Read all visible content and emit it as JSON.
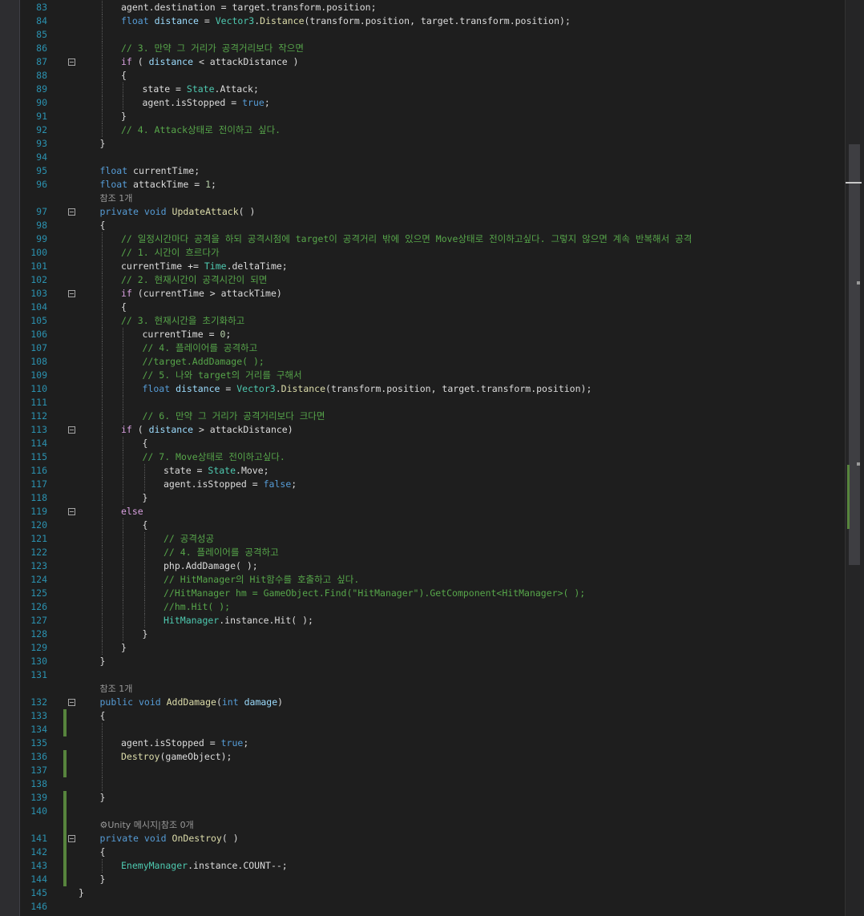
{
  "editor": {
    "lines": [
      {
        "type": "code",
        "ln": "83",
        "indent": 2,
        "fold": false,
        "chg": false,
        "tokens": [
          [
            "agent.",
            "p"
          ],
          [
            "destination",
            "p"
          ],
          [
            " = target.transform.position;",
            "p"
          ]
        ]
      },
      {
        "type": "code",
        "ln": "84",
        "indent": 2,
        "fold": false,
        "chg": false,
        "tokens": [
          [
            "float",
            "kw"
          ],
          [
            " ",
            "p"
          ],
          [
            "distance",
            "id"
          ],
          [
            " = ",
            "p"
          ],
          [
            "Vector3",
            "ty"
          ],
          [
            ".",
            "p"
          ],
          [
            "Distance",
            "mth"
          ],
          [
            "(transform.position, target.transform.position);",
            "p"
          ]
        ]
      },
      {
        "type": "code",
        "ln": "85",
        "indent": 2,
        "fold": false,
        "chg": false,
        "tokens": []
      },
      {
        "type": "code",
        "ln": "86",
        "indent": 2,
        "fold": false,
        "chg": false,
        "tokens": [
          [
            "// 3. 만약 그 거리가 공격거리보다 작으면",
            "cm"
          ]
        ]
      },
      {
        "type": "code",
        "ln": "87",
        "indent": 2,
        "fold": true,
        "chg": false,
        "tokens": [
          [
            "if",
            "ctl"
          ],
          [
            " ( ",
            "p"
          ],
          [
            "distance",
            "id"
          ],
          [
            " < attackDistance )",
            "p"
          ]
        ]
      },
      {
        "type": "code",
        "ln": "88",
        "indent": 2,
        "fold": false,
        "chg": false,
        "tokens": [
          [
            "{",
            "p"
          ]
        ]
      },
      {
        "type": "code",
        "ln": "89",
        "indent": 3,
        "fold": false,
        "chg": false,
        "tokens": [
          [
            "state = ",
            "p"
          ],
          [
            "State",
            "ty"
          ],
          [
            ".Attack;",
            "p"
          ]
        ]
      },
      {
        "type": "code",
        "ln": "90",
        "indent": 3,
        "fold": false,
        "chg": false,
        "tokens": [
          [
            "agent.isStopped = ",
            "p"
          ],
          [
            "true",
            "kw"
          ],
          [
            ";",
            "p"
          ]
        ]
      },
      {
        "type": "code",
        "ln": "91",
        "indent": 2,
        "fold": false,
        "chg": false,
        "tokens": [
          [
            "}",
            "p"
          ]
        ]
      },
      {
        "type": "code",
        "ln": "92",
        "indent": 2,
        "fold": false,
        "chg": false,
        "tokens": [
          [
            "// 4. Attack상태로 전이하고 싶다.",
            "cm"
          ]
        ]
      },
      {
        "type": "code",
        "ln": "93",
        "indent": 1,
        "fold": false,
        "chg": false,
        "tokens": [
          [
            "}",
            "p"
          ]
        ]
      },
      {
        "type": "code",
        "ln": "94",
        "indent": 1,
        "fold": false,
        "chg": false,
        "tokens": []
      },
      {
        "type": "code",
        "ln": "95",
        "indent": 1,
        "fold": false,
        "chg": false,
        "tokens": [
          [
            "float",
            "kw"
          ],
          [
            " currentTime;",
            "p"
          ]
        ]
      },
      {
        "type": "code",
        "ln": "96",
        "indent": 1,
        "fold": false,
        "chg": false,
        "tokens": [
          [
            "float",
            "kw"
          ],
          [
            " attackTime = ",
            "p"
          ],
          [
            "1",
            "num"
          ],
          [
            ";",
            "p"
          ]
        ]
      },
      {
        "type": "lens",
        "text": "참조 1개",
        "icon": ""
      },
      {
        "type": "code",
        "ln": "97",
        "indent": 1,
        "fold": true,
        "chg": false,
        "tokens": [
          [
            "private",
            "kw"
          ],
          [
            " ",
            "p"
          ],
          [
            "void",
            "kw"
          ],
          [
            " ",
            "p"
          ],
          [
            "UpdateAttack",
            "mth"
          ],
          [
            "( )",
            "p"
          ]
        ]
      },
      {
        "type": "code",
        "ln": "98",
        "indent": 1,
        "fold": false,
        "chg": false,
        "tokens": [
          [
            "{",
            "p"
          ]
        ]
      },
      {
        "type": "code",
        "ln": "99",
        "indent": 2,
        "fold": false,
        "chg": false,
        "tokens": [
          [
            "// 일정시간마다 공격을 하되 공격시점에 target이 공격거리 밖에 있으면 Move상태로 전이하고싶다. 그렇지 않으면 계속 반복해서 공격",
            "cm"
          ]
        ]
      },
      {
        "type": "code",
        "ln": "100",
        "indent": 2,
        "fold": false,
        "chg": false,
        "tokens": [
          [
            "// 1. 시간이 흐르다가",
            "cm"
          ]
        ]
      },
      {
        "type": "code",
        "ln": "101",
        "indent": 2,
        "fold": false,
        "chg": false,
        "tokens": [
          [
            "currentTime += ",
            "p"
          ],
          [
            "Time",
            "ty"
          ],
          [
            ".deltaTime;",
            "p"
          ]
        ]
      },
      {
        "type": "code",
        "ln": "102",
        "indent": 2,
        "fold": false,
        "chg": false,
        "tokens": [
          [
            "// 2. 현재시간이 공격시간이 되면",
            "cm"
          ]
        ]
      },
      {
        "type": "code",
        "ln": "103",
        "indent": 2,
        "fold": true,
        "chg": false,
        "tokens": [
          [
            "if",
            "ctl"
          ],
          [
            " (currentTime > attackTime)",
            "p"
          ]
        ]
      },
      {
        "type": "code",
        "ln": "104",
        "indent": 2,
        "fold": false,
        "chg": false,
        "tokens": [
          [
            "{",
            "p"
          ]
        ]
      },
      {
        "type": "code",
        "ln": "105",
        "indent": 2,
        "fold": false,
        "chg": false,
        "tokens": [
          [
            "// 3. 현재시간을 초기화하고",
            "cm"
          ]
        ]
      },
      {
        "type": "code",
        "ln": "106",
        "indent": 3,
        "fold": false,
        "chg": false,
        "tokens": [
          [
            "currentTime = ",
            "p"
          ],
          [
            "0",
            "num"
          ],
          [
            ";",
            "p"
          ]
        ]
      },
      {
        "type": "code",
        "ln": "107",
        "indent": 3,
        "fold": false,
        "chg": false,
        "tokens": [
          [
            "// 4. 플레이어를 공격하고",
            "cm"
          ]
        ]
      },
      {
        "type": "code",
        "ln": "108",
        "indent": 3,
        "fold": false,
        "chg": false,
        "tokens": [
          [
            "//target.AddDamage( );",
            "cm"
          ]
        ]
      },
      {
        "type": "code",
        "ln": "109",
        "indent": 3,
        "fold": false,
        "chg": false,
        "tokens": [
          [
            "// 5. 나와 target의 거리를 구해서",
            "cm"
          ]
        ]
      },
      {
        "type": "code",
        "ln": "110",
        "indent": 3,
        "fold": false,
        "chg": false,
        "tokens": [
          [
            "float",
            "kw"
          ],
          [
            " ",
            "p"
          ],
          [
            "distance",
            "id"
          ],
          [
            " = ",
            "p"
          ],
          [
            "Vector3",
            "ty"
          ],
          [
            ".",
            "p"
          ],
          [
            "Distance",
            "mth"
          ],
          [
            "(transform.position, target.transform.position);",
            "p"
          ]
        ]
      },
      {
        "type": "code",
        "ln": "111",
        "indent": 3,
        "fold": false,
        "chg": false,
        "tokens": []
      },
      {
        "type": "code",
        "ln": "112",
        "indent": 3,
        "fold": false,
        "chg": false,
        "tokens": [
          [
            "// 6. 만약 그 거리가 공격거리보다 크다면",
            "cm"
          ]
        ]
      },
      {
        "type": "code",
        "ln": "113",
        "indent": 2,
        "fold": true,
        "chg": false,
        "tokens": [
          [
            "if",
            "ctl"
          ],
          [
            " ( ",
            "p"
          ],
          [
            "distance",
            "id"
          ],
          [
            " > attackDistance)",
            "p"
          ]
        ]
      },
      {
        "type": "code",
        "ln": "114",
        "indent": 3,
        "fold": false,
        "chg": false,
        "tokens": [
          [
            "{",
            "p"
          ]
        ]
      },
      {
        "type": "code",
        "ln": "115",
        "indent": 3,
        "fold": false,
        "chg": false,
        "tokens": [
          [
            "// 7. Move상태로 전이하고싶다.",
            "cm"
          ]
        ]
      },
      {
        "type": "code",
        "ln": "116",
        "indent": 4,
        "fold": false,
        "chg": false,
        "tokens": [
          [
            "state = ",
            "p"
          ],
          [
            "State",
            "ty"
          ],
          [
            ".Move;",
            "p"
          ]
        ]
      },
      {
        "type": "code",
        "ln": "117",
        "indent": 4,
        "fold": false,
        "chg": false,
        "tokens": [
          [
            "agent.isStopped = ",
            "p"
          ],
          [
            "false",
            "kw"
          ],
          [
            ";",
            "p"
          ]
        ]
      },
      {
        "type": "code",
        "ln": "118",
        "indent": 3,
        "fold": false,
        "chg": false,
        "tokens": [
          [
            "}",
            "p"
          ]
        ]
      },
      {
        "type": "code",
        "ln": "119",
        "indent": 2,
        "fold": true,
        "chg": false,
        "tokens": [
          [
            "else",
            "ctl"
          ]
        ]
      },
      {
        "type": "code",
        "ln": "120",
        "indent": 3,
        "fold": false,
        "chg": false,
        "tokens": [
          [
            "{",
            "p"
          ]
        ]
      },
      {
        "type": "code",
        "ln": "121",
        "indent": 4,
        "fold": false,
        "chg": false,
        "tokens": [
          [
            "// 공격성공",
            "cm"
          ]
        ]
      },
      {
        "type": "code",
        "ln": "122",
        "indent": 4,
        "fold": false,
        "chg": false,
        "tokens": [
          [
            "// 4. 플레이어를 공격하고",
            "cm"
          ]
        ]
      },
      {
        "type": "code",
        "ln": "123",
        "indent": 4,
        "fold": false,
        "chg": false,
        "tokens": [
          [
            "php.AddDamage( );",
            "p"
          ]
        ]
      },
      {
        "type": "code",
        "ln": "124",
        "indent": 4,
        "fold": false,
        "chg": false,
        "tokens": [
          [
            "// HitManager의 Hit함수를 호출하고 싶다.",
            "cm"
          ]
        ]
      },
      {
        "type": "code",
        "ln": "125",
        "indent": 4,
        "fold": false,
        "chg": false,
        "tokens": [
          [
            "//HitManager hm = GameObject.Find(\"HitManager\").GetComponent<HitManager>( );",
            "cm"
          ]
        ]
      },
      {
        "type": "code",
        "ln": "126",
        "indent": 4,
        "fold": false,
        "chg": false,
        "tokens": [
          [
            "//hm.Hit( );",
            "cm"
          ]
        ]
      },
      {
        "type": "code",
        "ln": "127",
        "indent": 4,
        "fold": false,
        "chg": false,
        "tokens": [
          [
            "HitManager",
            "ty"
          ],
          [
            ".instance.Hit( );",
            "p"
          ]
        ]
      },
      {
        "type": "code",
        "ln": "128",
        "indent": 3,
        "fold": false,
        "chg": false,
        "tokens": [
          [
            "}",
            "p"
          ]
        ]
      },
      {
        "type": "code",
        "ln": "129",
        "indent": 2,
        "fold": false,
        "chg": false,
        "tokens": [
          [
            "}",
            "p"
          ]
        ]
      },
      {
        "type": "code",
        "ln": "130",
        "indent": 1,
        "fold": false,
        "chg": false,
        "tokens": [
          [
            "}",
            "p"
          ]
        ]
      },
      {
        "type": "code",
        "ln": "131",
        "indent": 1,
        "fold": false,
        "chg": false,
        "tokens": []
      },
      {
        "type": "lens",
        "text": "참조 1개",
        "icon": ""
      },
      {
        "type": "code",
        "ln": "132",
        "indent": 1,
        "fold": true,
        "chg": false,
        "tokens": [
          [
            "public",
            "kw"
          ],
          [
            " ",
            "p"
          ],
          [
            "void",
            "kw"
          ],
          [
            " ",
            "p"
          ],
          [
            "AddDamage",
            "mth"
          ],
          [
            "(",
            "p"
          ],
          [
            "int",
            "kw"
          ],
          [
            " ",
            "p"
          ],
          [
            "damage",
            "par"
          ],
          [
            ")",
            "p"
          ]
        ]
      },
      {
        "type": "code",
        "ln": "133",
        "indent": 1,
        "fold": false,
        "chg": true,
        "tokens": [
          [
            "{",
            "p"
          ]
        ]
      },
      {
        "type": "code",
        "ln": "134",
        "indent": 2,
        "fold": false,
        "chg": true,
        "tokens": []
      },
      {
        "type": "code",
        "ln": "135",
        "indent": 2,
        "fold": false,
        "chg": false,
        "tokens": [
          [
            "agent.isStopped = ",
            "p"
          ],
          [
            "true",
            "kw"
          ],
          [
            ";",
            "p"
          ]
        ]
      },
      {
        "type": "code",
        "ln": "136",
        "indent": 2,
        "fold": false,
        "chg": true,
        "tokens": [
          [
            "Destroy",
            "mth"
          ],
          [
            "(gameObject);",
            "p"
          ]
        ]
      },
      {
        "type": "code",
        "ln": "137",
        "indent": 2,
        "fold": false,
        "chg": true,
        "tokens": []
      },
      {
        "type": "code",
        "ln": "138",
        "indent": 2,
        "fold": false,
        "chg": false,
        "tokens": []
      },
      {
        "type": "code",
        "ln": "139",
        "indent": 1,
        "fold": false,
        "chg": true,
        "tokens": [
          [
            "}",
            "p"
          ]
        ]
      },
      {
        "type": "code",
        "ln": "140",
        "indent": 1,
        "fold": false,
        "chg": true,
        "tokens": []
      },
      {
        "type": "lens",
        "text": "Unity 메시지|참조 0개",
        "icon": "⚙",
        "chg": true
      },
      {
        "type": "code",
        "ln": "141",
        "indent": 1,
        "fold": true,
        "chg": true,
        "tokens": [
          [
            "private",
            "kw"
          ],
          [
            " ",
            "p"
          ],
          [
            "void",
            "kw"
          ],
          [
            " ",
            "p"
          ],
          [
            "OnDestroy",
            "mth"
          ],
          [
            "( )",
            "p"
          ]
        ]
      },
      {
        "type": "code",
        "ln": "142",
        "indent": 1,
        "fold": false,
        "chg": true,
        "tokens": [
          [
            "{",
            "p"
          ]
        ]
      },
      {
        "type": "code",
        "ln": "143",
        "indent": 2,
        "fold": false,
        "chg": true,
        "tokens": [
          [
            "EnemyManager",
            "ty"
          ],
          [
            ".instance.COUNT--;",
            "p"
          ]
        ]
      },
      {
        "type": "code",
        "ln": "144",
        "indent": 1,
        "fold": false,
        "chg": true,
        "tokens": [
          [
            "}",
            "p"
          ]
        ]
      },
      {
        "type": "code",
        "ln": "145",
        "indent": 0,
        "fold": false,
        "chg": false,
        "tokens": [
          [
            "}",
            "p"
          ]
        ]
      },
      {
        "type": "code",
        "ln": "146",
        "indent": 0,
        "fold": false,
        "chg": false,
        "tokens": []
      }
    ]
  },
  "scrollbar": {
    "marks": [
      {
        "color": "#c8c8c8"
      },
      {
        "color": "#9a9a9a"
      },
      {
        "color": "#9a9a9a"
      },
      {
        "color": "#57843d"
      }
    ]
  }
}
